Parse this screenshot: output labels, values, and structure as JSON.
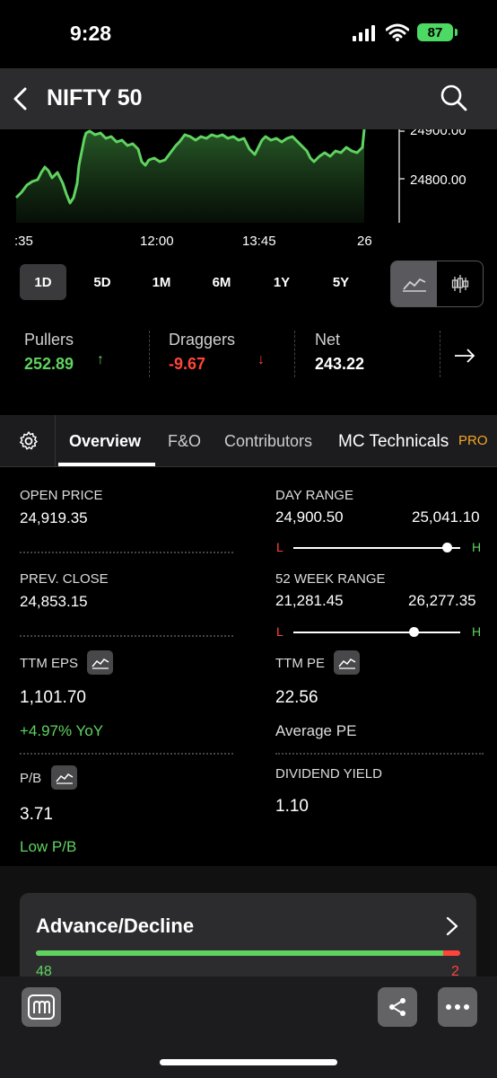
{
  "status": {
    "time": "9:28",
    "battery": "87",
    "accent": "#4cd964"
  },
  "header": {
    "title": "NIFTY 50",
    "back_icon": "chevron-left-icon",
    "search_icon": "search-icon"
  },
  "chart": {
    "y_ticks": [
      "24900.00",
      "24800.00"
    ],
    "x_ticks": [
      ":35",
      "12:00",
      "13:45",
      "26"
    ],
    "line_color": "#5fd35f"
  },
  "ranges": {
    "items": [
      "1D",
      "5D",
      "1M",
      "6M",
      "1Y",
      "5Y"
    ],
    "active": "1D"
  },
  "movers": {
    "pullers_label": "Pullers",
    "pullers_value": "252.89",
    "draggers_label": "Draggers",
    "draggers_value": "-9.67",
    "net_label": "Net",
    "net_value": "243.22"
  },
  "tabs": {
    "items": [
      "Overview",
      "F&O",
      "Contributors",
      "MC Technicals"
    ],
    "active": "Overview",
    "pro_badge": "PRO"
  },
  "overview": {
    "open_label": "OPEN PRICE",
    "open_value": "24,919.35",
    "day_range_label": "DAY RANGE",
    "day_low": "24,900.50",
    "day_high": "25,041.10",
    "day_position": 0.92,
    "prev_close_label": "PREV. CLOSE",
    "prev_close_value": "24,853.15",
    "week52_label": "52 WEEK RANGE",
    "week52_low": "21,281.45",
    "week52_high": "26,277.35",
    "week52_position": 0.72,
    "range_low_letter": "L",
    "range_high_letter": "H",
    "ttm_eps_label": "TTM EPS",
    "ttm_eps_value": "1,101.70",
    "ttm_eps_yoy": "+4.97% YoY",
    "ttm_pe_label": "TTM PE",
    "ttm_pe_value": "22.56",
    "ttm_pe_note": "Average PE",
    "pb_label": "P/B",
    "pb_value": "3.71",
    "pb_note": "Low P/B",
    "div_label": "DIVIDEND YIELD",
    "div_value": "1.10"
  },
  "advance_decline": {
    "title": "Advance/Decline",
    "advances": "48",
    "declines": "2",
    "advance_fraction": 0.96
  }
}
